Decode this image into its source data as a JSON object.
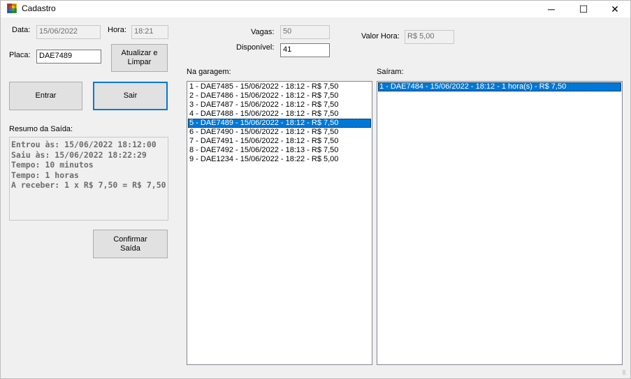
{
  "window": {
    "title": "Cadastro",
    "minimize_glyph": "─",
    "maximize_glyph": "☐",
    "close_glyph": "✕"
  },
  "form": {
    "data_label": "Data:",
    "data_value": "15/06/2022",
    "hora_label": "Hora:",
    "hora_value": "18:21",
    "placa_label": "Placa:",
    "placa_value": "DAE7489",
    "vagas_label": "Vagas:",
    "vagas_value": "50",
    "disponivel_label": "Disponível:",
    "disponivel_value": "41",
    "valor_hora_label": "Valor Hora:",
    "valor_hora_value": "R$ 5,00"
  },
  "buttons": {
    "atualizar_line1": "Atualizar e",
    "atualizar_line2": "Limpar",
    "entrar": "Entrar",
    "sair": "Sair",
    "confirmar_line1": "Confirmar",
    "confirmar_line2": "Saída"
  },
  "summary": {
    "label": "Resumo da Saída:",
    "lines": [
      "Entrou às: 15/06/2022 18:12:00",
      "Saiu às: 15/06/2022 18:22:29",
      "Tempo: 10 minutos",
      "Tempo: 1 horas",
      "A receber: 1 x R$ 7,50 = R$ 7,50"
    ]
  },
  "garagem": {
    "label": "Na garagem:",
    "selected_index": 4,
    "items": [
      "1 - DAE7485 - 15/06/2022 - 18:12 - R$ 7,50",
      "2 - DAE7486 - 15/06/2022 - 18:12 - R$ 7,50",
      "3 - DAE7487 - 15/06/2022 - 18:12 - R$ 7,50",
      "4 - DAE7488 - 15/06/2022 - 18:12 - R$ 7,50",
      "5 - DAE7489 - 15/06/2022 - 18:12 - R$ 7,50",
      "6 - DAE7490 - 15/06/2022 - 18:12 - R$ 7,50",
      "7 - DAE7491 - 15/06/2022 - 18:12 - R$ 7,50",
      "8 - DAE7492 - 15/06/2022 - 18:13 - R$ 7,50",
      "9 - DAE1234 - 15/06/2022 - 18:22 - R$ 5,00"
    ]
  },
  "sairam": {
    "label": "Saíram:",
    "selected_index": 0,
    "items": [
      "1 - DAE7484 - 15/06/2022 - 18:12 - 1 hora(s) - R$ 7,50"
    ]
  },
  "colors": {
    "selection": "#0078d7",
    "window_bg": "#f0f0f0"
  }
}
